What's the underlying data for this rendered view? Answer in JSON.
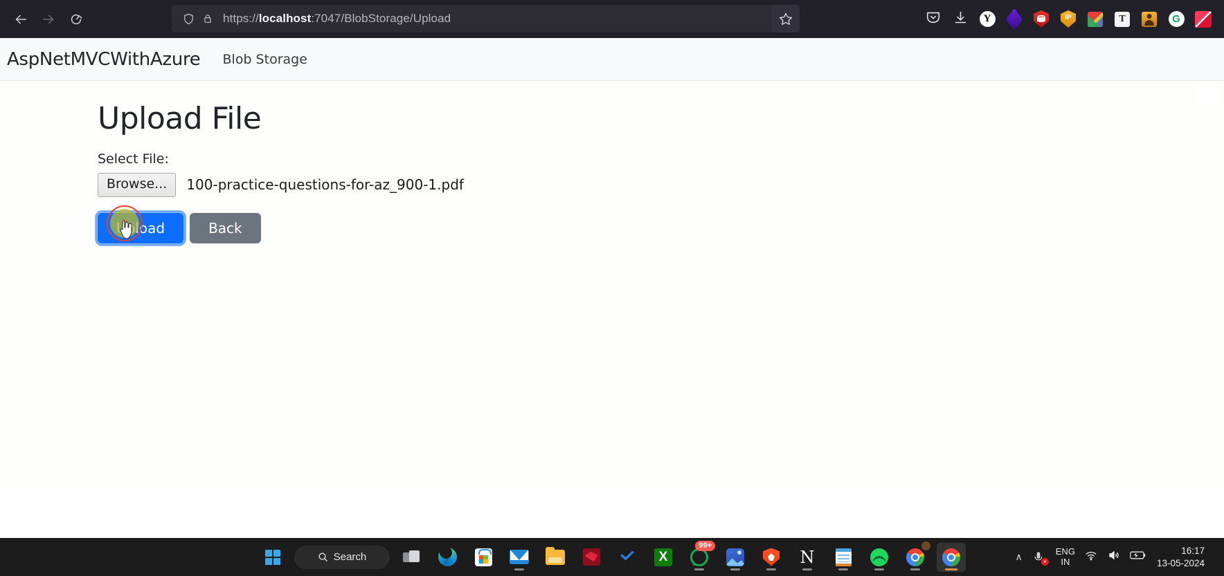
{
  "browser": {
    "back_icon": "arrow-left-icon",
    "forward_icon": "arrow-right-icon",
    "reload_icon": "reload-icon",
    "shield_icon": "shield-icon",
    "lock_icon": "padlock-icon",
    "url_prefix": "https://",
    "url_host": "localhost",
    "url_rest": ":7047/BlobStorage/Upload",
    "bookmark_icon": "star-icon",
    "extensions": [
      {
        "name": "pocket-icon",
        "label": ""
      },
      {
        "name": "download-icon",
        "label": ""
      },
      {
        "name": "yandex-icon",
        "label": "Y"
      },
      {
        "name": "purple-diamond-icon",
        "label": ""
      },
      {
        "name": "red-shield-lock-icon",
        "label": ""
      },
      {
        "name": "ip-shield-icon",
        "label": "IP"
      },
      {
        "name": "color-grid-icon",
        "label": ""
      },
      {
        "name": "text-tool-icon",
        "label": "T"
      },
      {
        "name": "person-badge-icon",
        "label": ""
      },
      {
        "name": "grammarly-icon",
        "label": "G"
      },
      {
        "name": "red-flag-icon",
        "label": ""
      }
    ]
  },
  "site": {
    "brand": "AspNetMVCWithAzure",
    "nav_link": "Blob Storage",
    "title": "Upload File",
    "select_file_label": "Select File:",
    "browse_button": "Browse...",
    "selected_file": "100-practice-questions-for-az_900-1.pdf",
    "upload_button": "Upload",
    "back_button": "Back"
  },
  "taskbar": {
    "start_icon": "windows-start-icon",
    "search_label": "Search",
    "search_icon": "search-icon",
    "items": [
      {
        "name": "taskview-icon"
      },
      {
        "name": "edge-icon"
      },
      {
        "name": "microsoft-store-icon"
      },
      {
        "name": "mail-icon"
      },
      {
        "name": "file-explorer-icon"
      },
      {
        "name": "kali-linux-icon"
      },
      {
        "name": "todo-check-icon"
      },
      {
        "name": "xbox-icon",
        "label": "X"
      },
      {
        "name": "whatsapp-icon",
        "badge": "99+"
      },
      {
        "name": "photos-icon"
      },
      {
        "name": "brave-icon"
      },
      {
        "name": "notion-icon",
        "label": "N"
      },
      {
        "name": "notepad-icon"
      },
      {
        "name": "spotify-icon"
      },
      {
        "name": "chrome-profile-icon"
      },
      {
        "name": "chrome-active-icon"
      }
    ],
    "tray": {
      "chevron": "∧",
      "mic_muted_icon": "microphone-muted-icon",
      "mic_x": "×",
      "language_primary": "ENG",
      "language_secondary": "IN",
      "wifi_icon": "wifi-icon",
      "volume_icon": "volume-icon",
      "battery_icon": "battery-icon",
      "time": "16:17",
      "date": "13-05-2024"
    }
  }
}
